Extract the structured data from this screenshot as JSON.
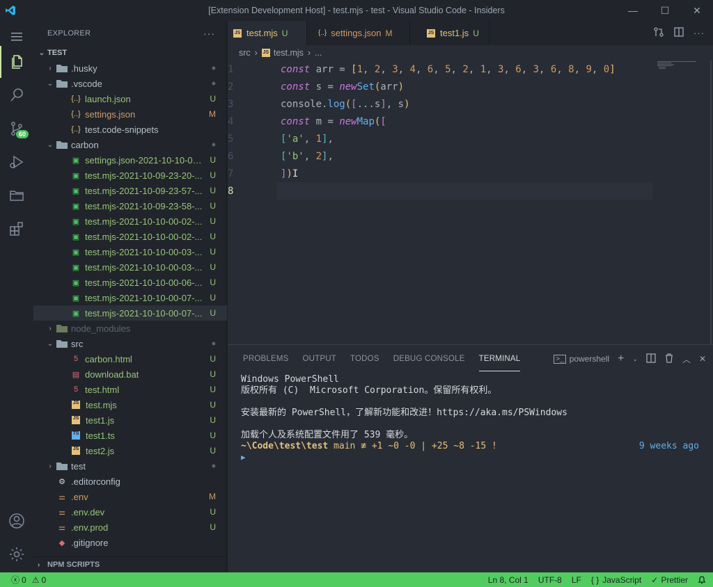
{
  "window": {
    "title": "[Extension Development Host] - test.mjs - test - Visual Studio Code - Insiders",
    "minimize": "—",
    "maximize": "☐",
    "close": "✕"
  },
  "colors": {
    "accent": "#52cc5e",
    "modified": "#d19a66",
    "untracked": "#98c379"
  },
  "activity_bar": {
    "items": [
      "files-icon",
      "search-icon",
      "source-control-icon",
      "run-debug-icon",
      "folder-icon",
      "extensions-icon"
    ],
    "scm_badge": "60",
    "bottom": [
      "account-icon",
      "settings-gear-icon"
    ]
  },
  "sidebar": {
    "title": "EXPLORER",
    "more": "···",
    "root": "TEST",
    "rows": [
      {
        "label": "husky",
        "prefix": ".",
        "status": "•",
        "depth": 1,
        "folder": true,
        "open": false
      },
      {
        "label": ".vscode",
        "status": "•",
        "depth": 1,
        "folder": true,
        "open": true
      },
      {
        "label": "launch.json",
        "status": "U",
        "depth": 2,
        "icon": "{..}"
      },
      {
        "label": "settings.json",
        "status": "M",
        "depth": 2,
        "icon": "{..}"
      },
      {
        "label": "test.code-snippets",
        "status": "",
        "depth": 2,
        "icon": "{..}"
      },
      {
        "label": "carbon",
        "status": "•",
        "depth": 1,
        "folder": true,
        "open": true
      },
      {
        "label": "settings.json-2021-10-10-00...",
        "status": "U",
        "depth": 2,
        "icon": "img"
      },
      {
        "label": "test.mjs-2021-10-09-23-20-...",
        "status": "U",
        "depth": 2,
        "icon": "img"
      },
      {
        "label": "test.mjs-2021-10-09-23-57-...",
        "status": "U",
        "depth": 2,
        "icon": "img"
      },
      {
        "label": "test.mjs-2021-10-09-23-58-...",
        "status": "U",
        "depth": 2,
        "icon": "img"
      },
      {
        "label": "test.mjs-2021-10-10-00-02-...",
        "status": "U",
        "depth": 2,
        "icon": "img"
      },
      {
        "label": "test.mjs-2021-10-10-00-02-...",
        "status": "U",
        "depth": 2,
        "icon": "img"
      },
      {
        "label": "test.mjs-2021-10-10-00-03-...",
        "status": "U",
        "depth": 2,
        "icon": "img"
      },
      {
        "label": "test.mjs-2021-10-10-00-03-...",
        "status": "U",
        "depth": 2,
        "icon": "img"
      },
      {
        "label": "test.mjs-2021-10-10-00-06-...",
        "status": "U",
        "depth": 2,
        "icon": "img"
      },
      {
        "label": "test.mjs-2021-10-10-00-07-...",
        "status": "U",
        "depth": 2,
        "icon": "img"
      },
      {
        "label": "test.mjs-2021-10-10-00-07-...",
        "status": "U",
        "depth": 2,
        "icon": "img",
        "selected": true
      },
      {
        "label": "node_modules",
        "status": "",
        "depth": 1,
        "folder": true,
        "open": false,
        "dim": true
      },
      {
        "label": "src",
        "status": "•",
        "depth": 1,
        "folder": true,
        "open": true
      },
      {
        "label": "carbon.html",
        "status": "U",
        "depth": 2,
        "icon": "html"
      },
      {
        "label": "download.bat",
        "status": "U",
        "depth": 2,
        "icon": "bat"
      },
      {
        "label": "test.html",
        "status": "U",
        "depth": 2,
        "icon": "html"
      },
      {
        "label": "test.mjs",
        "status": "U",
        "depth": 2,
        "icon": "js"
      },
      {
        "label": "test1.js",
        "status": "U",
        "depth": 2,
        "icon": "js"
      },
      {
        "label": "test1.ts",
        "status": "U",
        "depth": 2,
        "icon": "ts"
      },
      {
        "label": "test2.js",
        "status": "U",
        "depth": 2,
        "icon": "js"
      },
      {
        "label": "test",
        "status": "•",
        "depth": 1,
        "folder": true,
        "open": false
      },
      {
        "label": ".editorconfig",
        "status": "",
        "depth": 1,
        "icon": "cfg"
      },
      {
        "label": ".env",
        "status": "M",
        "depth": 1,
        "icon": "env"
      },
      {
        "label": ".env.dev",
        "status": "U",
        "depth": 1,
        "icon": "env"
      },
      {
        "label": ".env.prod",
        "status": "U",
        "depth": 1,
        "icon": "env"
      },
      {
        "label": ".gitignore",
        "status": "",
        "depth": 1,
        "icon": "git"
      }
    ],
    "npm_scripts": "NPM SCRIPTS"
  },
  "tabs": [
    {
      "label": "test.mjs",
      "badge": "U",
      "icon": "JS",
      "active": true
    },
    {
      "label": "settings.json",
      "badge": "M",
      "icon": "{..}",
      "active": false
    },
    {
      "label": "test1.js",
      "badge": "U",
      "icon": "JS",
      "active": false
    }
  ],
  "breadcrumb": {
    "folder": "src",
    "file": "test.mjs",
    "rest": "..."
  },
  "editor": {
    "line_numbers": [
      "1",
      "2",
      "3",
      "4",
      "5",
      "6",
      "7",
      "8"
    ],
    "current_line": "8"
  },
  "panel": {
    "tabs": [
      "PROBLEMS",
      "OUTPUT",
      "TODOS",
      "DEBUG CONSOLE",
      "TERMINAL"
    ],
    "active_tab": "TERMINAL",
    "shell": "powershell",
    "terminal_lines": [
      "Windows PowerShell",
      "版权所有 (C)  Microsoft Corporation。保留所有权利。",
      "",
      "安装最新的 PowerShell，了解新功能和改进！https://aka.ms/PSWindows",
      "",
      "加载个人及系统配置文件用了 539 毫秒。"
    ],
    "prompt_path": "~\\Code\\test\\test",
    "prompt_git": " main ≢ +1 ~0 -0 | +25 ~8 -15 !",
    "prompt_time": "9 weeks ago",
    "prompt_caret": "▶"
  },
  "status": {
    "errors": "0",
    "warnings": "0",
    "position": "Ln 8, Col 1",
    "encoding": "UTF-8",
    "eol": "LF",
    "language": "JavaScript",
    "language_prefix": "{ }",
    "formatter": "Prettier",
    "formatter_prefix": "✓"
  }
}
